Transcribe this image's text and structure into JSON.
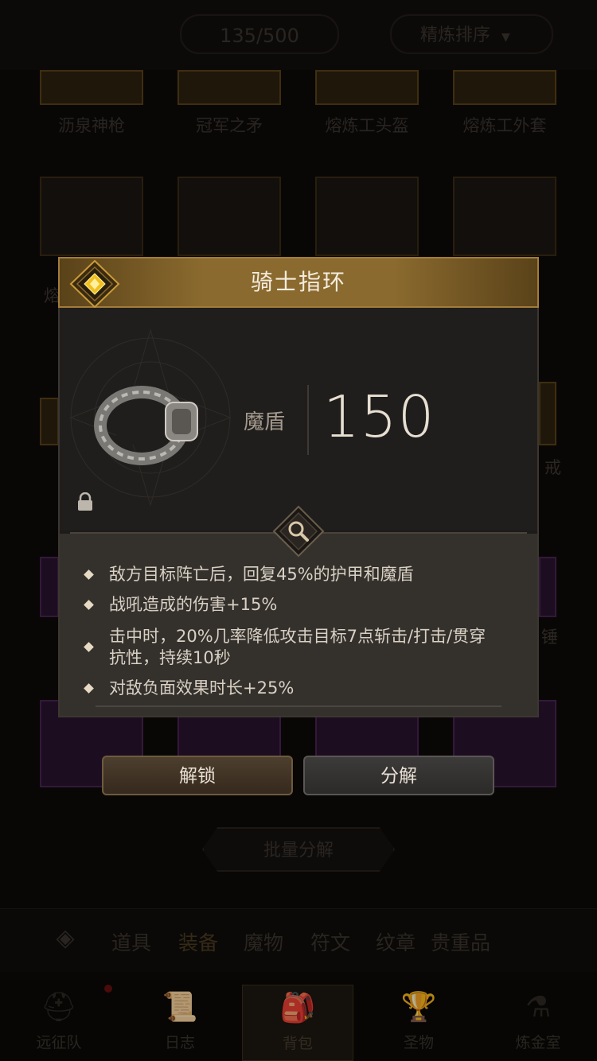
{
  "background": {
    "inventory_count": "135/500",
    "sort_label": "精炼排序",
    "item_names": [
      "沥泉神枪",
      "冠军之矛",
      "熔炼工头盔",
      "熔炼工外套"
    ],
    "side_fragments": [
      "熔",
      "戒",
      "锤"
    ],
    "batch_salvage_label": "批量分解",
    "category_tabs": [
      {
        "label": "道具",
        "active": false
      },
      {
        "label": "装备",
        "active": true
      },
      {
        "label": "魔物",
        "active": false
      },
      {
        "label": "符文",
        "active": false
      },
      {
        "label": "纹章",
        "active": false
      },
      {
        "label": "贵重品",
        "active": false
      }
    ],
    "bottom_nav": [
      {
        "label": "远征队",
        "icon": "helmet-icon",
        "active": false
      },
      {
        "label": "日志",
        "icon": "scroll-icon",
        "active": false
      },
      {
        "label": "背包",
        "icon": "backpack-icon",
        "active": true
      },
      {
        "label": "圣物",
        "icon": "chalice-icon",
        "active": false
      },
      {
        "label": "炼金室",
        "icon": "alchemy-icon",
        "active": false
      }
    ]
  },
  "item": {
    "name": "骑士指环",
    "rarity_color": "#e8b820",
    "locked": true,
    "main_stat_label": "魔盾",
    "main_stat_value": "150",
    "properties": [
      "敌方目标阵亡后，回复45%的护甲和魔盾",
      "战吼造成的伤害+15%",
      "击中时，20%几率降低攻击目标7点斩击/打击/贯穿抗性，持续10秒",
      "对敌负面效果时长+25%"
    ]
  },
  "actions": {
    "unlock_label": "解锁",
    "salvage_label": "分解"
  },
  "colors": {
    "header_gold": "#8a6a2e",
    "panel_dark": "#1e1c1a",
    "props_bg": "#34312d"
  }
}
